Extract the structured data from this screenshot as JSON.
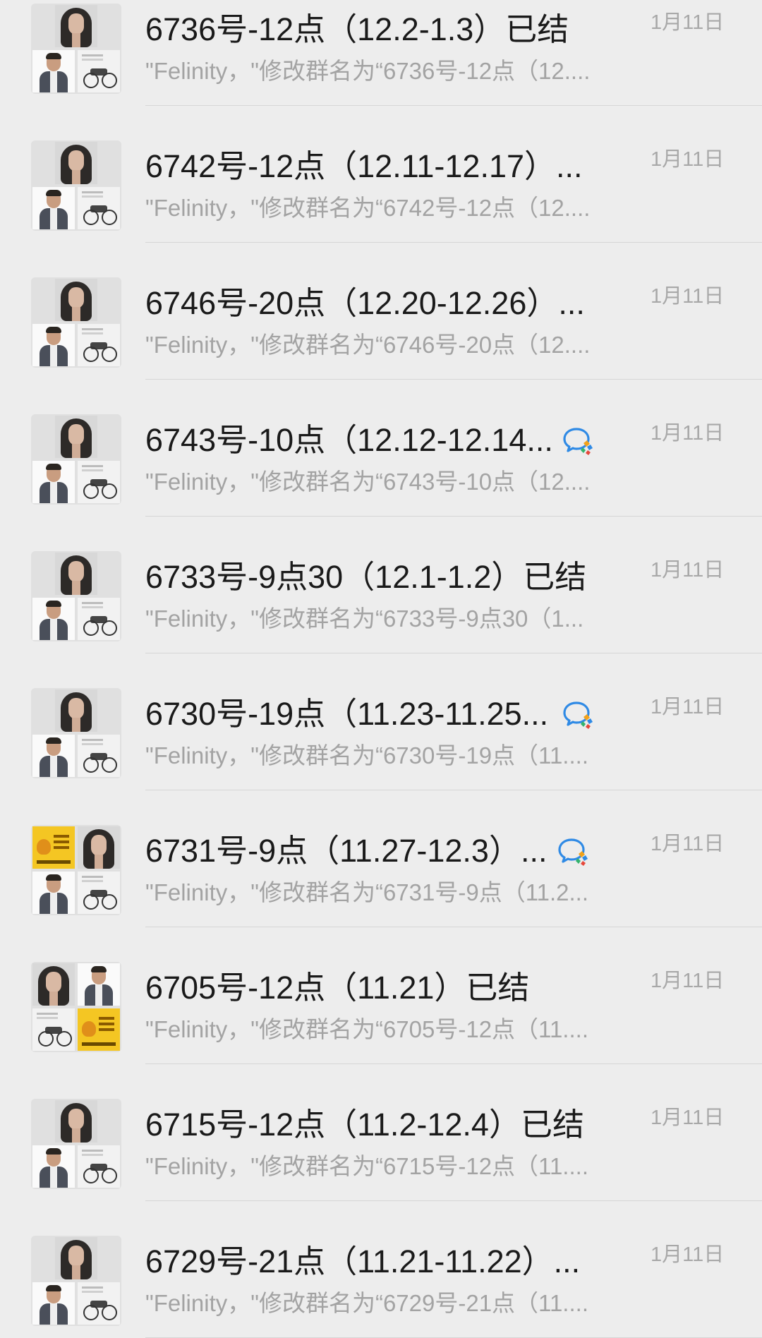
{
  "chats": [
    {
      "title": "6736号-12点（12.2-1.3）已结",
      "preview": "\"Felinity，\"修改群名为“6736号-12点（12....",
      "time": "1月11日",
      "wecom": false,
      "avatar": "standard"
    },
    {
      "title": "6742号-12点（12.11-12.17）...",
      "preview": "\"Felinity，\"修改群名为“6742号-12点（12....",
      "time": "1月11日",
      "wecom": false,
      "avatar": "standard"
    },
    {
      "title": "6746号-20点（12.20-12.26）...",
      "preview": "\"Felinity，\"修改群名为“6746号-20点（12....",
      "time": "1月11日",
      "wecom": false,
      "avatar": "standard"
    },
    {
      "title": "6743号-10点（12.12-12.14...",
      "preview": "\"Felinity，\"修改群名为“6743号-10点（12....",
      "time": "1月11日",
      "wecom": true,
      "avatar": "standard"
    },
    {
      "title": "6733号-9点30（12.1-1.2）已结",
      "preview": "\"Felinity，\"修改群名为“6733号-9点30（1...",
      "time": "1月11日",
      "wecom": false,
      "avatar": "standard"
    },
    {
      "title": "6730号-19点（11.23-11.25...",
      "preview": "\"Felinity，\"修改群名为“6730号-19点（11....",
      "time": "1月11日",
      "wecom": true,
      "avatar": "standard"
    },
    {
      "title": "6731号-9点（11.27-12.3）...",
      "preview": "\"Felinity，\"修改群名为“6731号-9点（11.2...",
      "time": "1月11日",
      "wecom": true,
      "avatar": "yellow-first"
    },
    {
      "title": "6705号-12点（11.21）已结",
      "preview": "\"Felinity，\"修改群名为“6705号-12点（11....",
      "time": "1月11日",
      "wecom": false,
      "avatar": "yellow-last"
    },
    {
      "title": "6715号-12点（11.2-12.4）已结",
      "preview": "\"Felinity，\"修改群名为“6715号-12点（11....",
      "time": "1月11日",
      "wecom": false,
      "avatar": "standard"
    },
    {
      "title": "6729号-21点（11.21-11.22）...",
      "preview": "\"Felinity，\"修改群名为“6729号-21点（11....",
      "time": "1月11日",
      "wecom": false,
      "avatar": "standard"
    }
  ],
  "icons": {
    "wecom": "wecom-badge-icon"
  },
  "colors": {
    "background": "#ededed",
    "title": "#1a1a1a",
    "preview": "#a3a3a3",
    "time": "#a8a8a8",
    "divider": "#d6d6d6",
    "wecom_blue": "#2f8ae5",
    "wecom_orange": "#f2a21a"
  }
}
